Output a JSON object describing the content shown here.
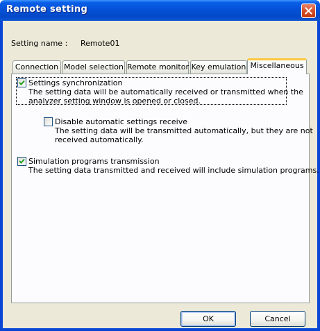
{
  "window": {
    "title": "Remote setting"
  },
  "setting_name": {
    "label": "Setting name :",
    "value": "Remote01"
  },
  "tabs": [
    {
      "label": "Connection",
      "active": false
    },
    {
      "label": "Model selection",
      "active": false
    },
    {
      "label": "Remote monitor",
      "active": false
    },
    {
      "label": "Key emulation",
      "active": false
    },
    {
      "label": "Miscellaneous",
      "active": true
    }
  ],
  "options": {
    "settings_sync": {
      "label": "Settings synchronization",
      "checked": true,
      "desc_line1": "The setting data will be automatically received or transmitted when the",
      "desc_line2": "analyzer setting window is opened or closed."
    },
    "disable_receive": {
      "label": "Disable automatic settings receive",
      "checked": false,
      "desc_line1": "The setting data will be transmitted automatically, but they are not",
      "desc_line2": "received automatically."
    },
    "simulation": {
      "label": "Simulation programs transmission",
      "checked": true,
      "desc_line1": "The setting data transmitted and received will include simulation programs."
    }
  },
  "buttons": {
    "ok": "OK",
    "cancel": "Cancel"
  },
  "colors": {
    "title_bar": "#0552d8",
    "dialog_bg": "#ece9d8",
    "active_tab_accent": "#ffc83c",
    "close_button": "#d9542e"
  },
  "icons": {
    "close": "close-icon",
    "check": "checkmark-icon"
  }
}
